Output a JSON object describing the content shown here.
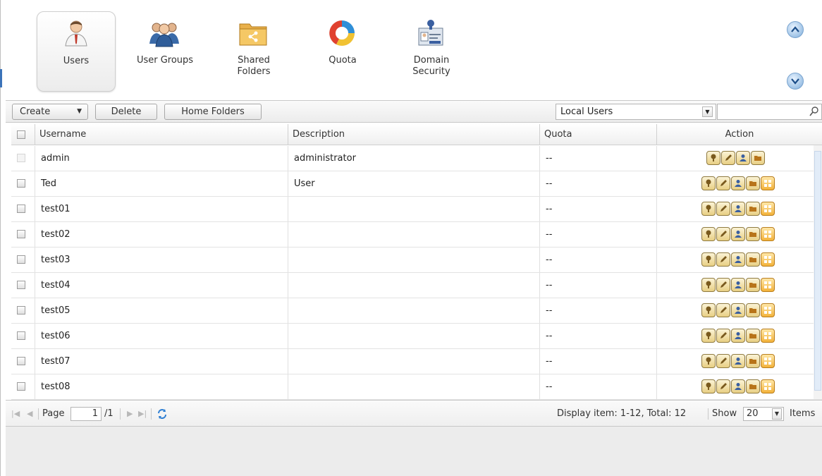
{
  "nav": [
    {
      "label": "Users",
      "icon": "user-icon",
      "active": true
    },
    {
      "label": "User Groups",
      "icon": "user-groups-icon",
      "active": false
    },
    {
      "label": "Shared Folders",
      "icon": "shared-folder-icon",
      "active": false
    },
    {
      "label": "Quota",
      "icon": "quota-pie-icon",
      "active": false
    },
    {
      "label": "Domain Security",
      "icon": "domain-security-icon",
      "active": false
    }
  ],
  "toolbar": {
    "create_label": "Create",
    "delete_label": "Delete",
    "home_folders_label": "Home Folders",
    "filter_value": "Local Users",
    "search_value": ""
  },
  "table": {
    "columns": [
      "Username",
      "Description",
      "Quota",
      "Action"
    ],
    "rows": [
      {
        "username": "admin",
        "description": "administrator",
        "quota": "--",
        "actions": 4,
        "checkbox_enabled": false
      },
      {
        "username": "Ted",
        "description": "User",
        "quota": "--",
        "actions": 5,
        "checkbox_enabled": true
      },
      {
        "username": "test01",
        "description": "",
        "quota": "--",
        "actions": 5,
        "checkbox_enabled": true
      },
      {
        "username": "test02",
        "description": "",
        "quota": "--",
        "actions": 5,
        "checkbox_enabled": true
      },
      {
        "username": "test03",
        "description": "",
        "quota": "--",
        "actions": 5,
        "checkbox_enabled": true
      },
      {
        "username": "test04",
        "description": "",
        "quota": "--",
        "actions": 5,
        "checkbox_enabled": true
      },
      {
        "username": "test05",
        "description": "",
        "quota": "--",
        "actions": 5,
        "checkbox_enabled": true
      },
      {
        "username": "test06",
        "description": "",
        "quota": "--",
        "actions": 5,
        "checkbox_enabled": true
      },
      {
        "username": "test07",
        "description": "",
        "quota": "--",
        "actions": 5,
        "checkbox_enabled": true
      },
      {
        "username": "test08",
        "description": "",
        "quota": "--",
        "actions": 5,
        "checkbox_enabled": true
      }
    ],
    "action_icons": [
      "change-password-icon",
      "edit-profile-icon",
      "edit-group-icon",
      "edit-shared-folder-icon",
      "edit-quota-icon"
    ]
  },
  "pager": {
    "page_label": "Page",
    "page_value": "1",
    "page_total": "/1",
    "display_text": "Display item: 1-12, Total: 12",
    "show_label": "Show",
    "show_value": "20",
    "items_label": "Items"
  },
  "colors": {
    "accent": "#3b73b9",
    "action_button": "#e8cf84",
    "quota_button": "#f3b23a"
  }
}
